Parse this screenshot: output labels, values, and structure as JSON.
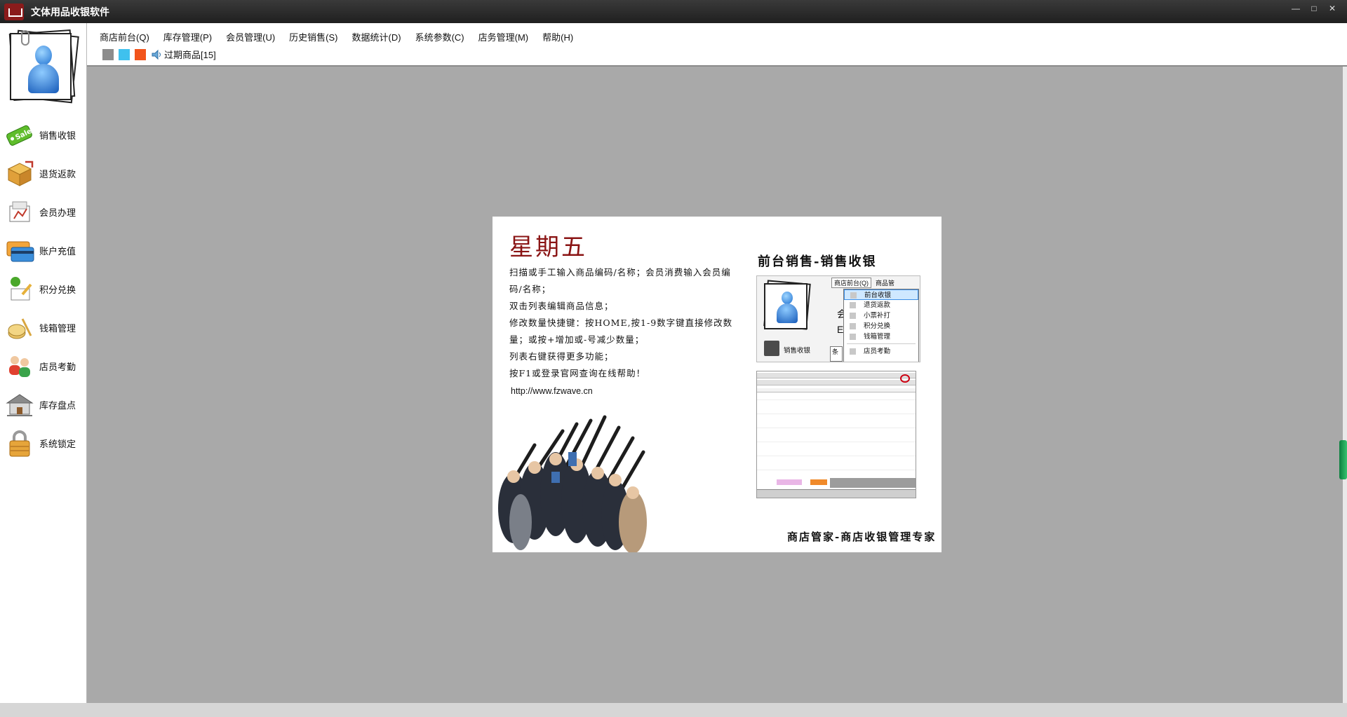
{
  "window": {
    "title": "文体用品收银软件",
    "controls": [
      "—",
      "□",
      "✕"
    ]
  },
  "sidebar": {
    "items": [
      {
        "label": "销售收银",
        "icon": "sale-tag-icon"
      },
      {
        "label": "退货返款",
        "icon": "return-box-icon"
      },
      {
        "label": "会员办理",
        "icon": "member-card-icon"
      },
      {
        "label": "账户充值",
        "icon": "credit-card-icon"
      },
      {
        "label": "积分兑换",
        "icon": "points-exchange-icon"
      },
      {
        "label": "钱箱管理",
        "icon": "cash-box-icon"
      },
      {
        "label": "店员考勤",
        "icon": "staff-attendance-icon"
      },
      {
        "label": "库存盘点",
        "icon": "warehouse-icon"
      },
      {
        "label": "系统锁定",
        "icon": "padlock-icon"
      }
    ]
  },
  "menubar": {
    "items": [
      "商店前台(Q)",
      "库存管理(P)",
      "会员管理(U)",
      "历史销售(S)",
      "数据统计(D)",
      "系统参数(C)",
      "店务管理(M)",
      "帮助(H)"
    ]
  },
  "toolbar": {
    "colors": [
      "#8c8c8c",
      "#3fc1ee",
      "#f2541b"
    ],
    "expired_label": "过期商品[15]"
  },
  "splash": {
    "weekday": "星期五",
    "tips": [
      "扫描或手工输入商品编码/名称；会员消费输入会员编码/名称；",
      "双击列表编辑商品信息；",
      "修改数量快捷键：按HOME,按1-9数字键直接修改数量；或按+增加或-号减少数量；",
      "列表右键获得更多功能；",
      "按F1或登录官网查询在线帮助！"
    ],
    "url": "http://www.fzwave.cn",
    "section_title": "前台销售-销售收银",
    "slogan": "商店管家-商店收银管理专家",
    "shot1": {
      "menu_q": "商店前台(Q)",
      "menu_next": "商品管",
      "dropdown": [
        "前台收银",
        "退货返款",
        "小票补打",
        "积分兑换",
        "钱箱管理",
        "店员考勤"
      ],
      "cash_label": "销售收银",
      "frag": [
        "会",
        "E",
        "条"
      ]
    }
  },
  "colors": {
    "workspace": "#a9a9a9",
    "weekday": "#8a1414",
    "titlebar": "#2a2a2a"
  }
}
